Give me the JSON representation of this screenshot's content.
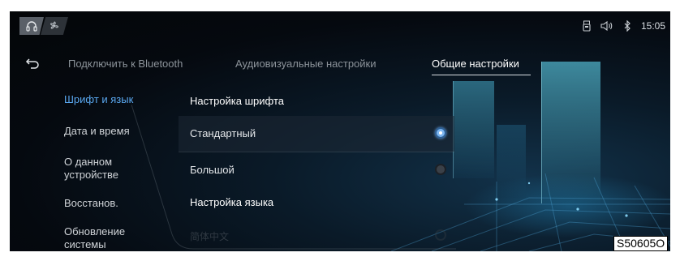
{
  "status_bar": {
    "mode_buttons": [
      {
        "icon": "headphones-icon",
        "active": true
      },
      {
        "icon": "fan-icon",
        "active": false
      }
    ],
    "icons": [
      "usb-icon",
      "volume-icon",
      "bluetooth-icon"
    ],
    "time": "15:05"
  },
  "tabs": [
    {
      "label": "Подключить к Bluetooth",
      "active": false
    },
    {
      "label": "Аудиовизуальные настройки",
      "active": false
    },
    {
      "label": "Общие настройки",
      "active": true
    }
  ],
  "sidebar": {
    "items": [
      {
        "label": "Шрифт и язык",
        "active": true
      },
      {
        "label": "Дата и время",
        "active": false
      },
      {
        "label": "О данном устройстве",
        "active": false
      },
      {
        "label": "Восстанов.",
        "active": false
      },
      {
        "label": "Обновление системы",
        "active": false
      }
    ]
  },
  "content": {
    "font_section_title": "Настройка шрифта",
    "font_options": [
      {
        "label": "Стандартный",
        "selected": true
      },
      {
        "label": "Большой",
        "selected": false
      }
    ],
    "language_section_title": "Настройка языка",
    "faded_item": "简体中文"
  },
  "figure_code": "S50605O",
  "colors": {
    "accent": "#5aa8f0",
    "background": "#05090f",
    "text": "#e4e7ea",
    "muted_text": "#8c939a"
  }
}
